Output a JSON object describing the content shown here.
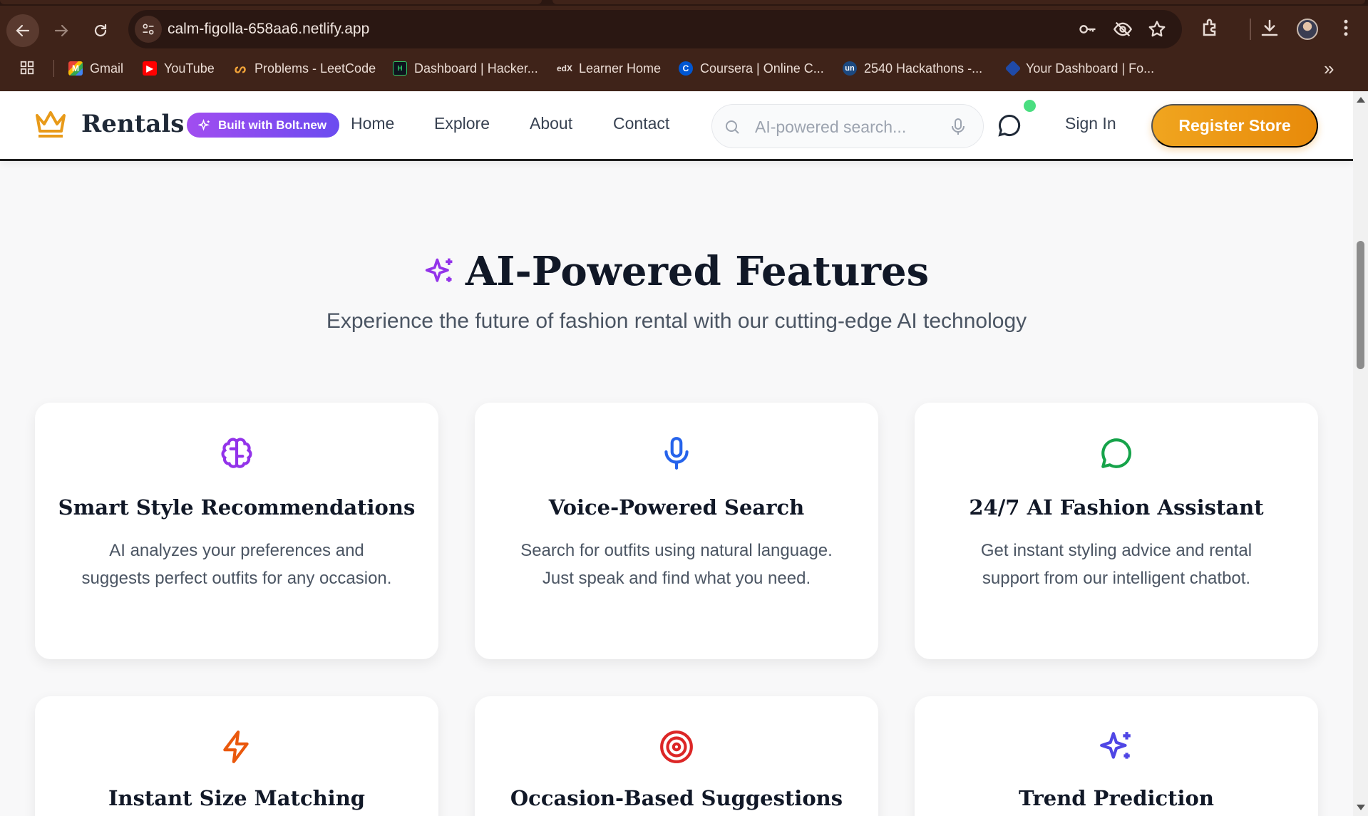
{
  "browser": {
    "url": "calm-figolla-658aa6.netlify.app",
    "bookmarks": [
      {
        "label": "Gmail",
        "icon": "gmail-icon"
      },
      {
        "label": "YouTube",
        "icon": "youtube-icon"
      },
      {
        "label": "Problems - LeetCode",
        "icon": "leetcode-icon"
      },
      {
        "label": "Dashboard | Hacker...",
        "icon": "hackerrank-icon"
      },
      {
        "label": "Learner Home",
        "icon": "edx-icon"
      },
      {
        "label": "Coursera | Online C...",
        "icon": "coursera-icon"
      },
      {
        "label": "2540 Hackathons -...",
        "icon": "unstop-icon"
      },
      {
        "label": "Your Dashboard | Fo...",
        "icon": "dashboard-icon"
      }
    ],
    "more_bookmarks": "»"
  },
  "header": {
    "brand": "Rentals",
    "badge": "Built with Bolt.new",
    "nav": [
      "Home",
      "Explore",
      "About",
      "Contact"
    ],
    "search_placeholder": "AI-powered search...",
    "sign_in": "Sign In",
    "register": "Register Store"
  },
  "section": {
    "title": "AI-Powered Features",
    "subtitle": "Experience the future of fashion rental with our cutting-edge AI technology"
  },
  "features": [
    {
      "title": "Smart Style Recommendations",
      "text": "AI analyzes your preferences and suggests perfect outfits for any occasion.",
      "icon": "brain-icon",
      "color": "#9333ea"
    },
    {
      "title": "Voice-Powered Search",
      "text": "Search for outfits using natural language. Just speak and find what you need.",
      "icon": "microphone-icon",
      "color": "#2563eb"
    },
    {
      "title": "24/7 AI Fashion Assistant",
      "text": "Get instant styling advice and rental support from our intelligent chatbot.",
      "icon": "chat-bubble-icon",
      "color": "#16a34a"
    },
    {
      "title": "Instant Size Matching",
      "text": "",
      "icon": "lightning-icon",
      "color": "#ea580c"
    },
    {
      "title": "Occasion-Based Suggestions",
      "text": "",
      "icon": "target-icon",
      "color": "#dc2626"
    },
    {
      "title": "Trend Prediction",
      "text": "",
      "icon": "sparkles-icon",
      "color": "#4f46e5"
    }
  ]
}
